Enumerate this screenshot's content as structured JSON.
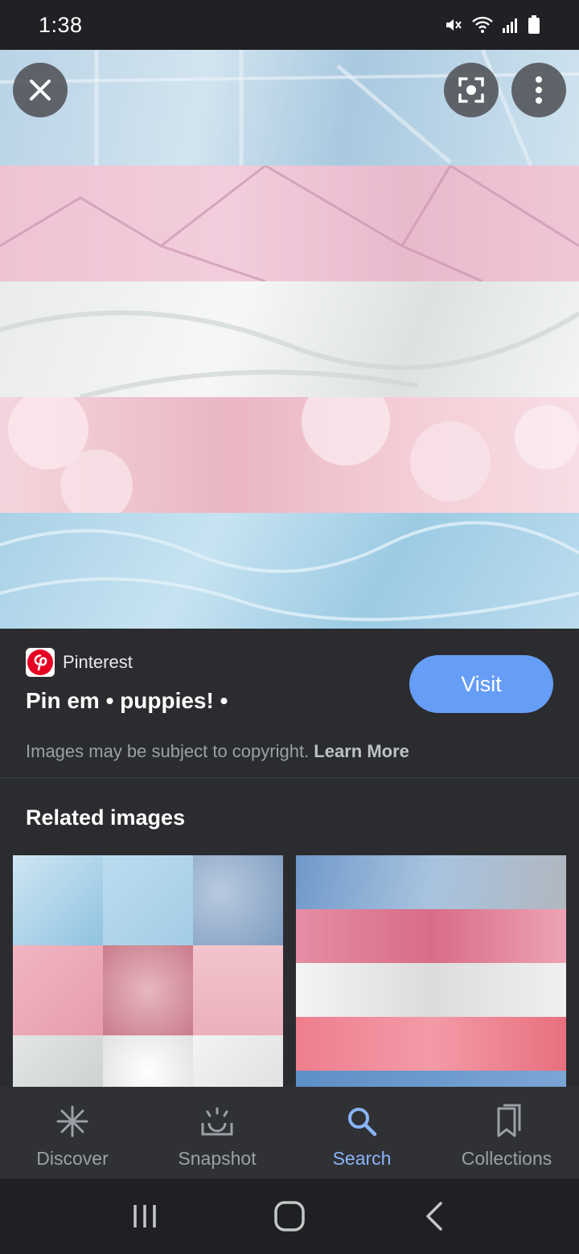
{
  "status_bar": {
    "time": "1:38"
  },
  "hero": {
    "colors": [
      "#b9d3e6",
      "#efc3d4",
      "#eef0ef",
      "#f0c6d2",
      "#aed3e8"
    ]
  },
  "info": {
    "source": "Pinterest",
    "title": "Pin em • puppies! •",
    "visit_label": "Visit",
    "copyright": "Images may be subject to copyright.",
    "learn_more": "Learn More"
  },
  "related": {
    "heading": "Related images"
  },
  "bottom_nav": {
    "items": [
      {
        "label": "Discover",
        "icon": "asterisk-icon"
      },
      {
        "label": "Snapshot",
        "icon": "snapshot-icon"
      },
      {
        "label": "Search",
        "icon": "search-icon",
        "active": true
      },
      {
        "label": "Collections",
        "icon": "collections-icon"
      }
    ]
  },
  "colors": {
    "accent": "#8ab4f8",
    "visit_button": "#669df6",
    "pinterest_red": "#e60023"
  }
}
